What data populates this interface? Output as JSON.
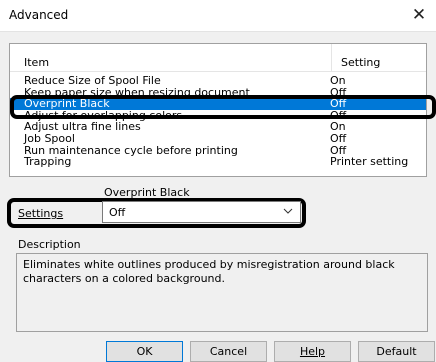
{
  "window": {
    "title": "Advanced",
    "close_symbol": "✕"
  },
  "list": {
    "header": {
      "item": "Item",
      "setting": "Setting"
    },
    "rows": [
      {
        "item": "Reduce Size of Spool File",
        "setting": "On"
      },
      {
        "item": "Keep paper size when resizing document",
        "setting": "Off"
      },
      {
        "item": "Overprint Black",
        "setting": "Off",
        "selected": true
      },
      {
        "item": "Adjust for overlapping colors",
        "setting": "Off"
      },
      {
        "item": "Adjust ultra fine lines",
        "setting": "On"
      },
      {
        "item": "Job Spool",
        "setting": "Off"
      },
      {
        "item": "Run maintenance cycle before printing",
        "setting": "Off"
      },
      {
        "item": "Trapping",
        "setting": "Printer setting"
      }
    ]
  },
  "settings_group": {
    "title": "Overprint Black",
    "label": "Settings",
    "value": "Off"
  },
  "description": {
    "label": "Description",
    "text": "Eliminates white outlines produced by misregistration around black characters on a colored background."
  },
  "buttons": {
    "ok": "OK",
    "cancel": "Cancel",
    "help": "Help",
    "default": "Default"
  },
  "colors": {
    "selection": "#0078d7",
    "annotation": "#000000"
  }
}
